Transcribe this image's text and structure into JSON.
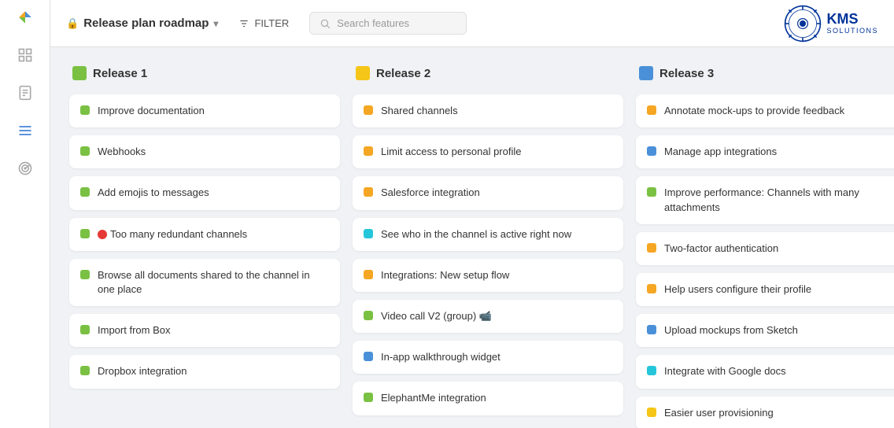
{
  "app": {
    "title": "Release plan roadmap",
    "filter_label": "FILTER",
    "search_placeholder": "Search features"
  },
  "kms": {
    "name": "KMS",
    "sub": "SOLUTIONS"
  },
  "sidebar": {
    "items": [
      {
        "name": "grid-icon",
        "label": "Grid"
      },
      {
        "name": "document-icon",
        "label": "Document"
      },
      {
        "name": "list-icon",
        "label": "List"
      },
      {
        "name": "radar-icon",
        "label": "Radar"
      }
    ]
  },
  "columns": [
    {
      "id": "release1",
      "title": "Release 1",
      "flag_color": "#7ac143",
      "cards": [
        {
          "text": "Improve documentation",
          "dot": "green"
        },
        {
          "text": "Webhooks",
          "dot": "green"
        },
        {
          "text": "Add emojis to messages",
          "dot": "green"
        },
        {
          "text": "Too many redundant channels",
          "dot": "green",
          "has_red": true
        },
        {
          "text": "Browse all documents shared to the channel in one place",
          "dot": "green"
        },
        {
          "text": "Import from Box",
          "dot": "green"
        },
        {
          "text": "Dropbox integration",
          "dot": "green"
        }
      ]
    },
    {
      "id": "release2",
      "title": "Release 2",
      "flag_color": "#f5c518",
      "cards": [
        {
          "text": "Shared channels",
          "dot": "orange"
        },
        {
          "text": "Limit access to personal profile",
          "dot": "orange"
        },
        {
          "text": "Salesforce integration",
          "dot": "orange"
        },
        {
          "text": "See who in the channel is active right now",
          "dot": "teal"
        },
        {
          "text": "Integrations: New setup flow",
          "dot": "orange"
        },
        {
          "text": "Video call V2 (group) 📹",
          "dot": "green"
        },
        {
          "text": "In-app walkthrough widget",
          "dot": "blue"
        },
        {
          "text": "ElephantMe integration",
          "dot": "green"
        }
      ]
    },
    {
      "id": "release3",
      "title": "Release 3",
      "flag_color": "#4a90d9",
      "cards": [
        {
          "text": "Annotate mock-ups to provide feedback",
          "dot": "orange"
        },
        {
          "text": "Manage app integrations",
          "dot": "blue"
        },
        {
          "text": "Improve performance: Channels with many attachments",
          "dot": "green"
        },
        {
          "text": "Two-factor authentication",
          "dot": "orange"
        },
        {
          "text": "Help users configure their profile",
          "dot": "orange"
        },
        {
          "text": "Upload mockups from Sketch",
          "dot": "blue"
        },
        {
          "text": "Integrate with Google docs",
          "dot": "teal"
        },
        {
          "text": "Easier user provisioning",
          "dot": "yellow"
        }
      ]
    }
  ]
}
